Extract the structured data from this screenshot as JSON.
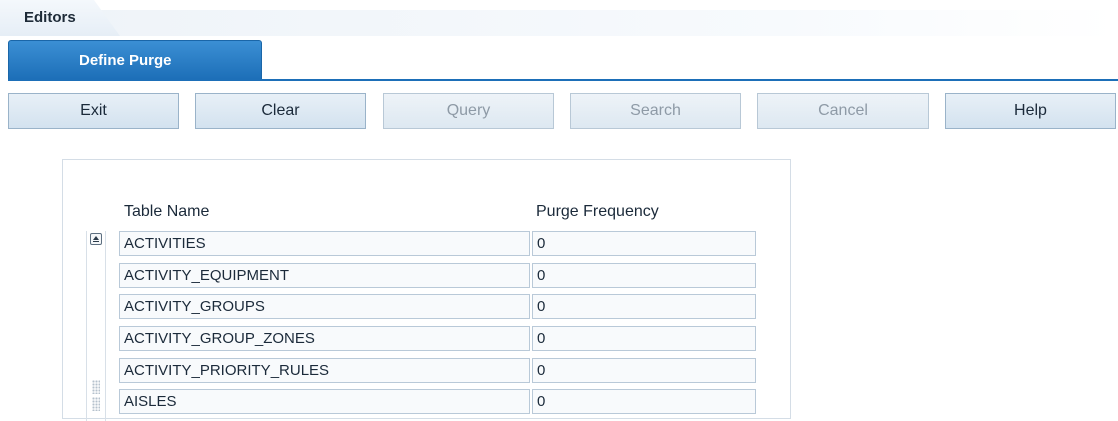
{
  "editors": {
    "title": "Editors"
  },
  "tab": {
    "label": "Define Purge"
  },
  "toolbar": {
    "buttons": [
      {
        "label": "Exit",
        "enabled": true
      },
      {
        "label": "Clear",
        "enabled": true
      },
      {
        "label": "Query",
        "enabled": false
      },
      {
        "label": "Search",
        "enabled": false
      },
      {
        "label": "Cancel",
        "enabled": false
      },
      {
        "label": "Help",
        "enabled": true
      }
    ]
  },
  "table": {
    "columns": [
      "Table Name",
      "Purge Frequency"
    ],
    "rows": [
      {
        "name": "ACTIVITIES",
        "frequency": "0"
      },
      {
        "name": "ACTIVITY_EQUIPMENT",
        "frequency": "0"
      },
      {
        "name": "ACTIVITY_GROUPS",
        "frequency": "0"
      },
      {
        "name": "ACTIVITY_GROUP_ZONES",
        "frequency": "0"
      },
      {
        "name": "ACTIVITY_PRIORITY_RULES",
        "frequency": "0"
      },
      {
        "name": "AISLES",
        "frequency": "0"
      }
    ]
  },
  "colors": {
    "accent": "#1d6fb8",
    "button_bg": "#dce8f2",
    "disabled_text": "#8e9aa6"
  }
}
